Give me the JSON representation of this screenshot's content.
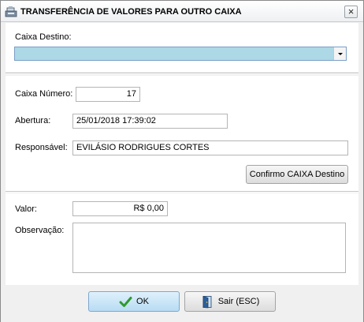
{
  "window": {
    "title": "TRANSFERÊNCIA DE VALORES PARA OUTRO CAIXA",
    "close_glyph": "×",
    "title_icon": "cash-register-icon"
  },
  "destino": {
    "label": "Caixa Destino:",
    "selected_value": ""
  },
  "caixa": {
    "numero_label": "Caixa Número:",
    "numero_value": "17",
    "abertura_label": "Abertura:",
    "abertura_value": "25/01/2018 17:39:02",
    "responsavel_label": "Responsável:",
    "responsavel_value": "EVILÁSIO RODRIGUES CORTES",
    "confirm_button": "Confirmo CAIXA Destino"
  },
  "transfer": {
    "valor_label": "Valor:",
    "valor_value": "R$ 0,00",
    "observacao_label": "Observação:",
    "observacao_value": ""
  },
  "footer": {
    "ok_label": "OK",
    "ok_icon": "checkmark-icon",
    "exit_label": "Sair (ESC)",
    "exit_icon": "exit-door-icon"
  },
  "colors": {
    "combo_fill": "#add8e6",
    "ok_button": "#c6e4f7",
    "check_green": "#2f9a2f"
  }
}
